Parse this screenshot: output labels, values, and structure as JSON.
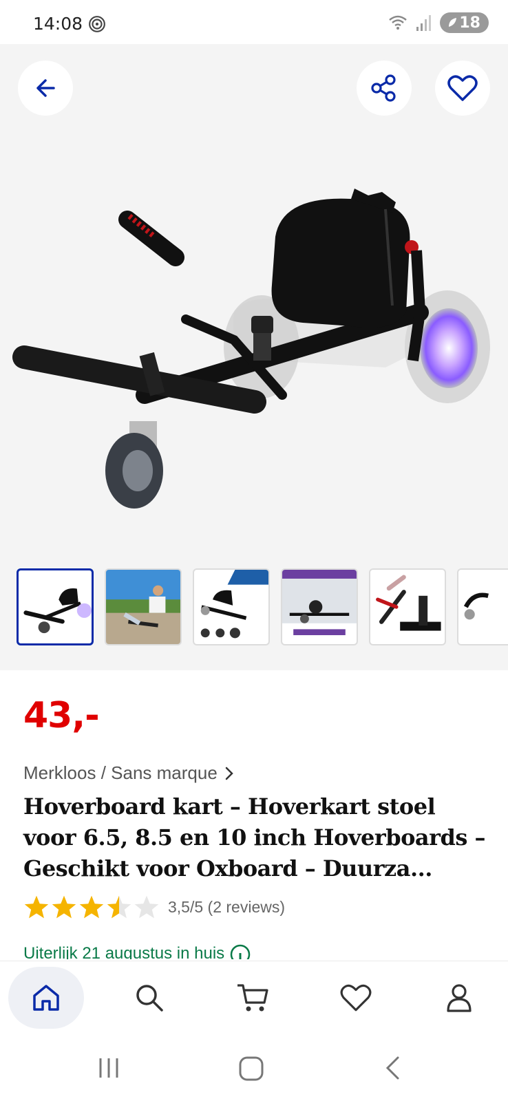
{
  "status_bar": {
    "time": "14:08",
    "battery": "18"
  },
  "product": {
    "price": "43,-",
    "brand": "Merkloos / Sans marque",
    "title": "Hoverboard kart – Hoverkart stoel voor 6.5, 8.5 en 10 inch Hoverboards – Geschikt voor Oxboard – Duurza...",
    "rating": 3.5,
    "rating_text": "3,5/5 (2 reviews)",
    "delivery": "Uiterlijk 21 augustus in huis"
  },
  "thumbnails": {
    "count_visible": 6,
    "active_index": 0
  },
  "icons": {
    "back": "arrow-left-icon",
    "share": "share-icon",
    "favorite": "heart-icon",
    "nav": [
      "home-icon",
      "search-icon",
      "cart-icon",
      "heart-icon",
      "user-icon"
    ]
  },
  "colors": {
    "accent": "#0a2aa8",
    "price": "#e00000",
    "delivery": "#0a7a48",
    "star": "#f5b400"
  }
}
